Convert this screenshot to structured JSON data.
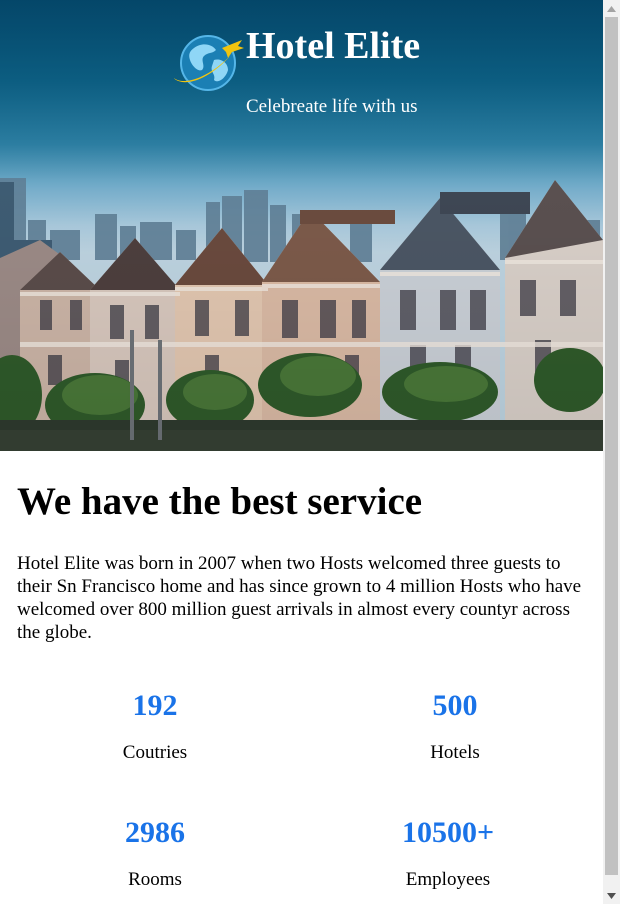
{
  "hero": {
    "title": "Hotel Elite",
    "subtitle": "Celebreate life with us",
    "logo_icon": "globe-airplane-icon"
  },
  "about": {
    "heading": "We have the best service",
    "paragraph": "Hotel Elite was born in 2007 when two Hosts welcomed three guests to their Sn Francisco home and has since grown to 4 million Hosts who have welcomed over 800 million guest arrivals in almost every countyr across the globe."
  },
  "stats": [
    {
      "value": "192",
      "label": "Coutries"
    },
    {
      "value": "500",
      "label": "Hotels"
    },
    {
      "value": "2986",
      "label": "Rooms"
    },
    {
      "value": "10500+",
      "label": "Employees"
    }
  ],
  "colors": {
    "stat_number": "#1a73e8",
    "hero_sky": "#06577c"
  }
}
